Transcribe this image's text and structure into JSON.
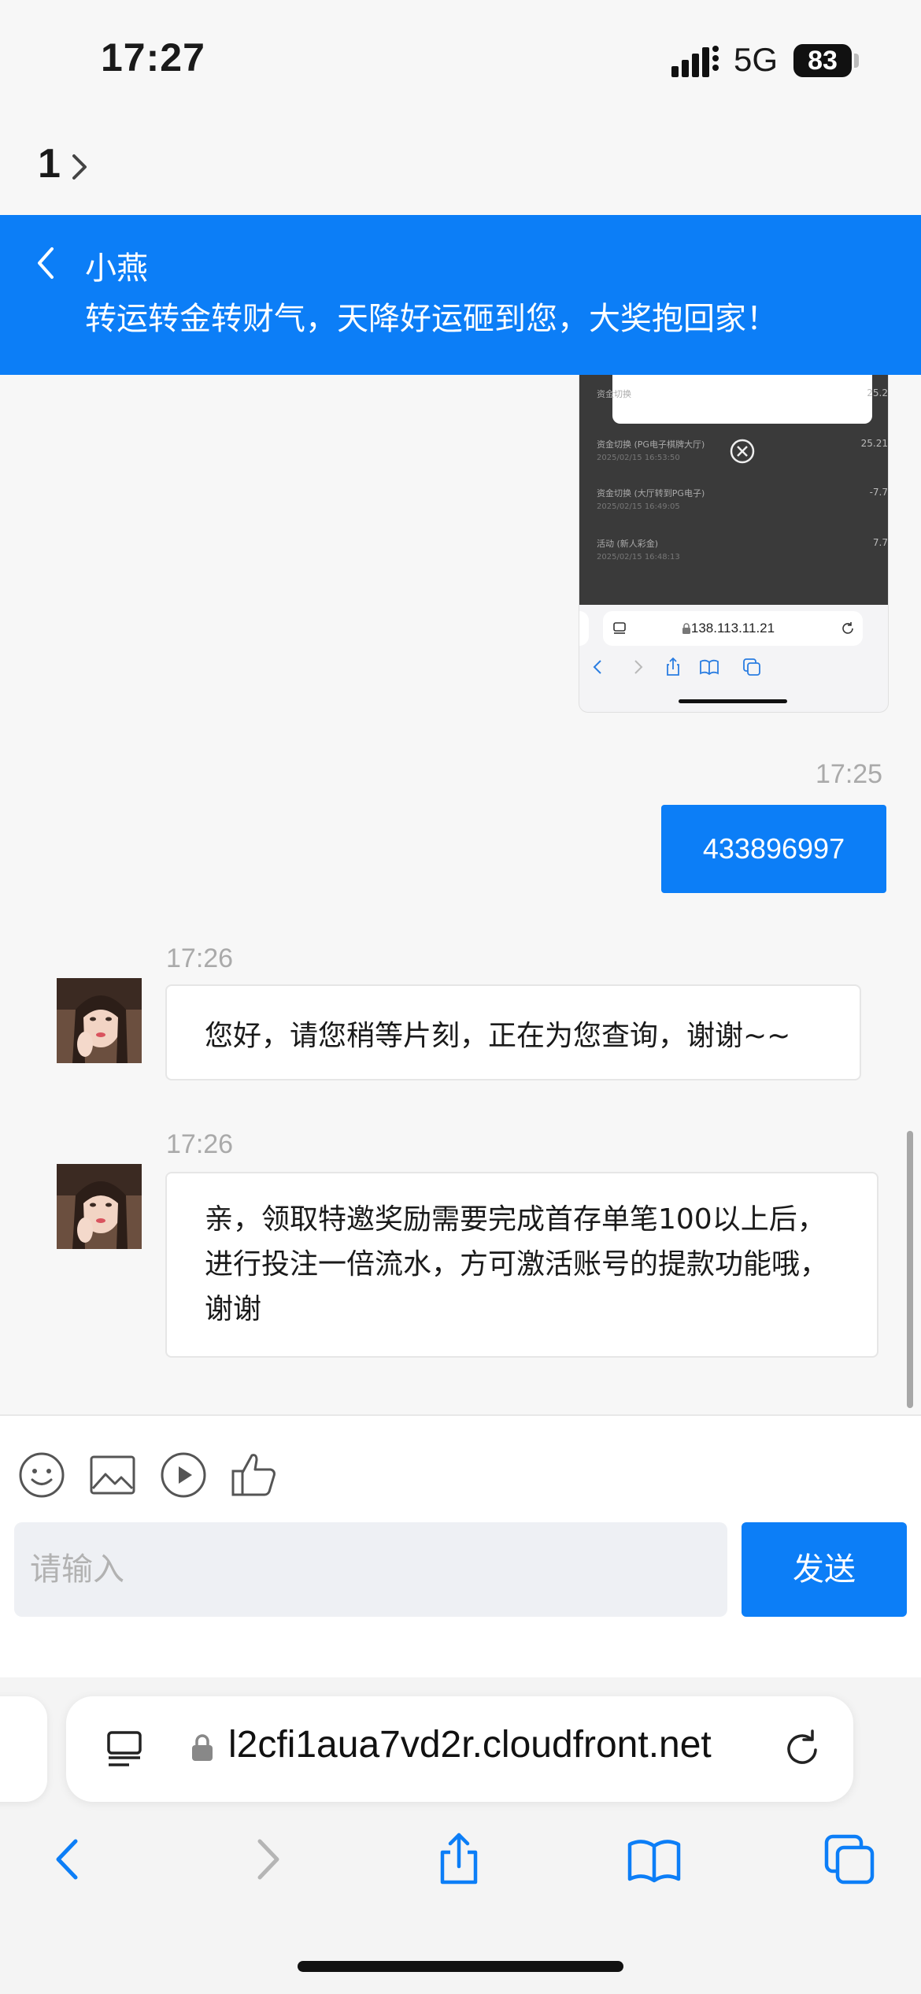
{
  "status_bar": {
    "time": "17:27",
    "network": "5G",
    "battery": "83",
    "icons": [
      "signal-icon",
      "battery-icon"
    ]
  },
  "back_row": {
    "count": "1",
    "icon": "chevron-right-icon"
  },
  "chat_header": {
    "name": "小燕",
    "subtitle": "转运转金转财气，天降好运砸到您，大奖抱回家！",
    "back_icon": "chevron-left-icon",
    "color": "#0c7ef7"
  },
  "screenshot_thumb": {
    "rows": [
      {
        "title": "资金切换",
        "date": "",
        "amount": "25.2"
      },
      {
        "title": "资金切换 (PG电子棋牌大厅)",
        "date": "2025/02/15 16:53:50",
        "amount": "25.21"
      },
      {
        "title": "资金切换 (大厅转到PG电子)",
        "date": "2025/02/15 16:49:05",
        "amount": "-7.7"
      },
      {
        "title": "活动 (新人彩金)",
        "date": "2025/02/15 16:48:13",
        "amount": "7.7"
      }
    ],
    "url": "138.113.11.21",
    "icons": [
      "close-circle-icon",
      "tabs-icon",
      "lock-icon",
      "reload-icon",
      "back-icon",
      "forward-icon",
      "share-icon",
      "bookmarks-icon",
      "tabs-overview-icon"
    ]
  },
  "messages": [
    {
      "time": "17:25",
      "type": "sent",
      "text": "433896997"
    },
    {
      "time": "17:26",
      "type": "received",
      "text": "您好，请您稍等片刻，正在为您查询，谢谢~~"
    },
    {
      "time": "17:26",
      "type": "received",
      "text": "亲，领取特邀奖励需要完成首存单笔100以上后，进行投注一倍流水，方可激活账号的提款功能哦，谢谢"
    }
  ],
  "toolbar": {
    "icons": [
      "emoji-icon",
      "image-icon",
      "video-icon",
      "thumbs-up-icon"
    ]
  },
  "composer": {
    "placeholder": "请输入",
    "value": "",
    "send_label": "发送"
  },
  "browser": {
    "url": "l2cfi1aua7vd2r.cloudfront.net",
    "icons": [
      "page-menu-icon",
      "lock-icon",
      "reload-icon",
      "back-icon",
      "forward-icon",
      "share-icon",
      "bookmarks-icon",
      "tabs-icon"
    ]
  }
}
